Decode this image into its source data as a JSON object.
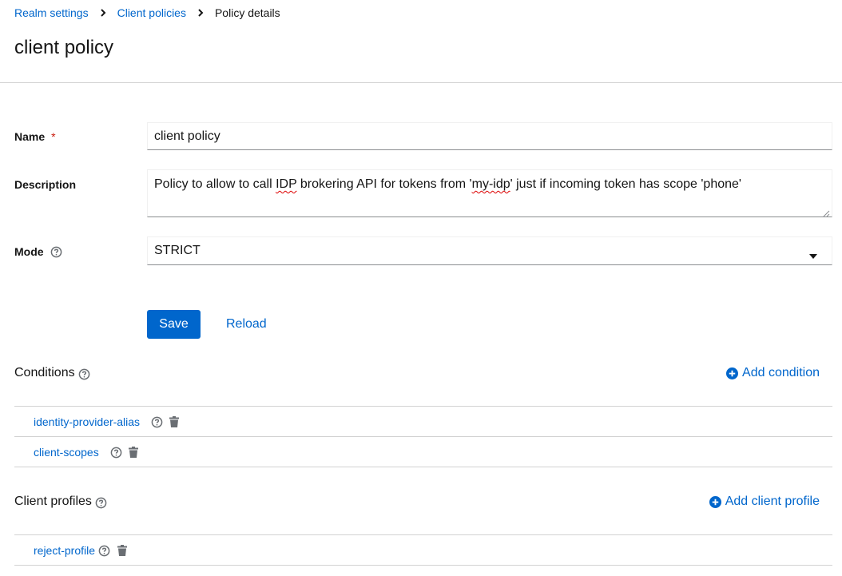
{
  "breadcrumb": {
    "items": [
      "Realm settings",
      "Client policies"
    ],
    "current": "Policy details"
  },
  "page": {
    "title": "client policy"
  },
  "form": {
    "name_label": "Name",
    "required_mark": "*",
    "name_value": "client policy",
    "description_label": "Description",
    "description_parts": [
      "Policy to allow to call ",
      "IDP",
      " brokering API for tokens from '",
      "my-idp",
      "' just if incoming token has scope 'phone'"
    ],
    "mode_label": "Mode",
    "mode_value": "STRICT"
  },
  "actions": {
    "save_label": "Save",
    "reload_label": "Reload"
  },
  "conditions": {
    "title": "Conditions",
    "add_label": "Add condition",
    "items": [
      {
        "label": "identity-provider-alias"
      },
      {
        "label": "client-scopes"
      }
    ]
  },
  "profiles": {
    "title": "Client profiles",
    "add_label": "Add client profile",
    "items": [
      {
        "label": "reject-profile"
      }
    ]
  },
  "colors": {
    "link": "#0066cc",
    "primary": "#0066cc",
    "required": "#c9190b",
    "icon_gray": "#6a6e73",
    "divider": "#d2d2d2"
  }
}
